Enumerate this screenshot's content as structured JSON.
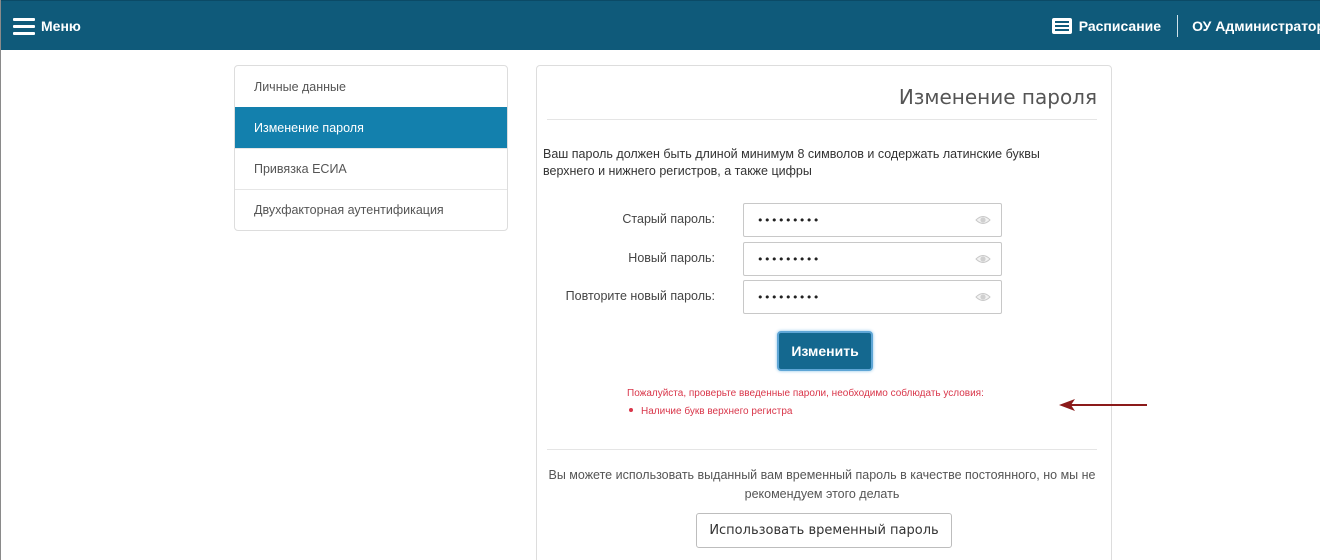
{
  "header": {
    "menu_label": "Меню",
    "schedule_label": "Расписание",
    "user_label": "ОУ Администратор"
  },
  "sidebar": {
    "items": [
      {
        "label": "Личные данные",
        "active": false
      },
      {
        "label": "Изменение пароля",
        "active": true
      },
      {
        "label": "Привязка ЕСИА",
        "active": false
      },
      {
        "label": "Двухфакторная аутентификация",
        "active": false
      }
    ]
  },
  "main": {
    "title": "Изменение пароля",
    "hint": "Ваш пароль должен быть длиной минимум 8 символов и содержать латинские буквы верхнего и нижнего регистров, а также цифры",
    "fields": [
      {
        "label": "Старый пароль:",
        "value": "•••••••••"
      },
      {
        "label": "Новый пароль:",
        "value": "•••••••••"
      },
      {
        "label": "Повторите новый пароль:",
        "value": "•••••••••"
      }
    ],
    "submit_label": "Изменить",
    "error_message": "Пожалуйста, проверьте введенные пароли, необходимо соблюдать условия:",
    "error_items": [
      "Наличие букв верхнего регистра"
    ],
    "temp_note": "Вы можете использовать выданный вам временный пароль в качестве постоянного, но мы не рекомендуем этого делать",
    "temp_button_label": "Использовать временный пароль"
  },
  "colors": {
    "header_bg": "#0f5a7a",
    "active_item": "#1380ad",
    "primary_button": "#14688f",
    "error_text": "#d9364a",
    "annotation_arrow": "#8b1a1a"
  },
  "icons": {
    "menu": "hamburger-icon",
    "schedule": "list-icon",
    "password_toggle": "eye-icon"
  }
}
